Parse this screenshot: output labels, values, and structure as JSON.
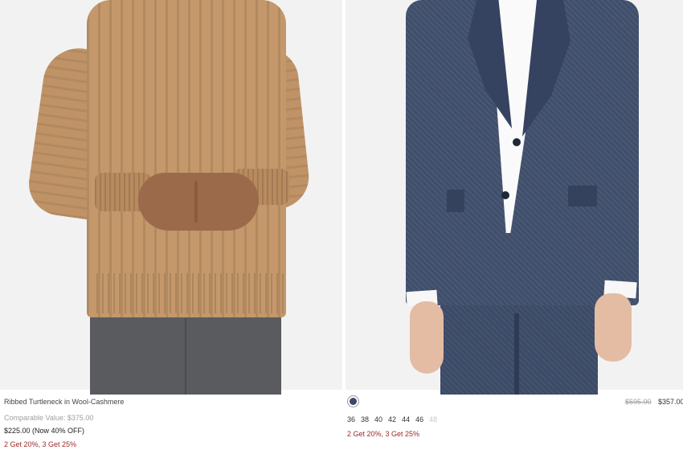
{
  "products": [
    {
      "name": "Ribbed Turtleneck in Wool-Cashmere",
      "comparable_value": "Comparable Value: $375.00",
      "sale_price": "$225.00 (Now 40% OFF)",
      "promo": "2 Get 20%, 3 Get 25%",
      "image_subject": "camel ribbed turtleneck sweater"
    },
    {
      "swatch_color": "#3b4a66",
      "sizes": [
        {
          "label": "36",
          "available": true
        },
        {
          "label": "38",
          "available": true
        },
        {
          "label": "40",
          "available": true
        },
        {
          "label": "42",
          "available": true
        },
        {
          "label": "44",
          "available": true
        },
        {
          "label": "46",
          "available": true
        },
        {
          "label": "48",
          "available": false
        }
      ],
      "original_price": "$595.00",
      "price": "$357.00",
      "promo": "2 Get 20%, 3 Get 25%",
      "image_subject": "navy suit jacket and trousers"
    }
  ],
  "colors": {
    "promo": "#a02a2a",
    "muted": "#a0a0a0",
    "unavailable": "#c8c8c8"
  }
}
